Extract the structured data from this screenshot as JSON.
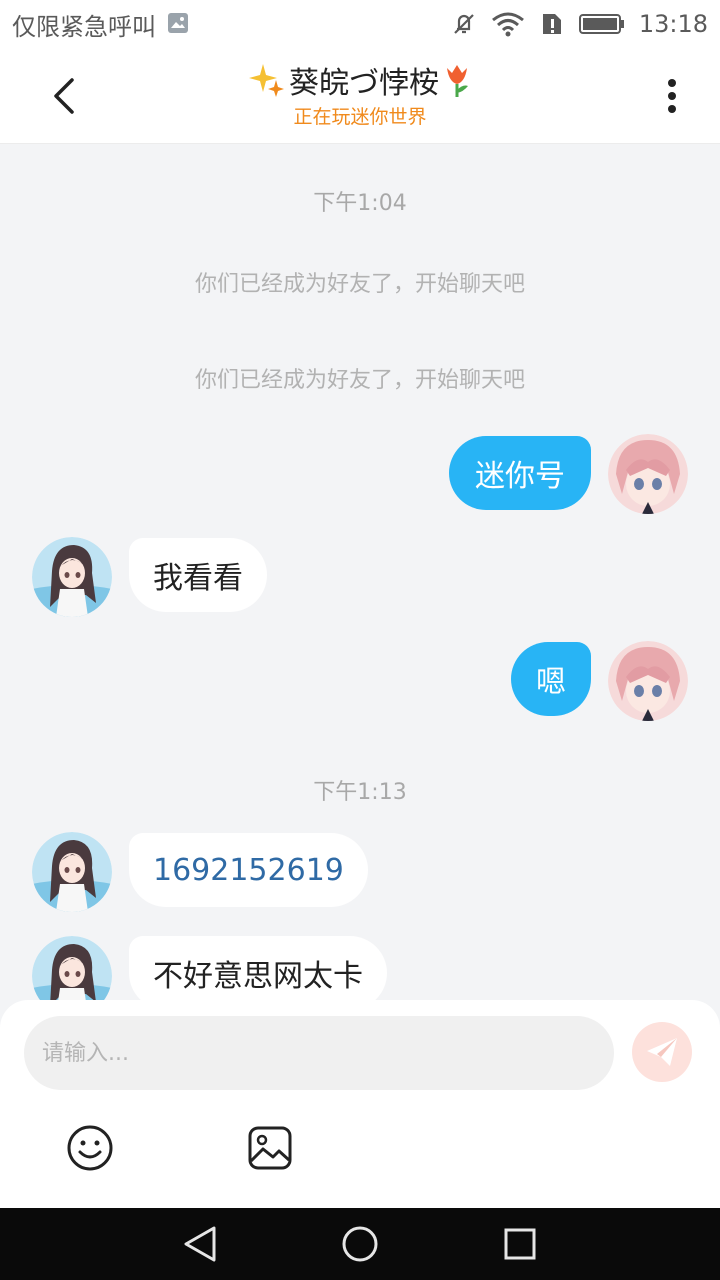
{
  "status_bar": {
    "carrier": "仅限紧急呼叫",
    "time": "13:18"
  },
  "header": {
    "back_icon": "chevron-left-icon",
    "title": "葵皖づ悖桉",
    "subtitle": "正在玩迷你世界",
    "more_icon": "vertical-ellipsis-icon",
    "accent_color": "#f08a1c"
  },
  "chat": {
    "timestamps": [
      "下午1:04",
      "下午1:13"
    ],
    "system_messages": [
      "你们已经成为好友了，开始聊天吧",
      "你们已经成为好友了，开始聊天吧"
    ],
    "messages": [
      {
        "side": "right",
        "text": "迷你号"
      },
      {
        "side": "left",
        "text": "我看看"
      },
      {
        "side": "right",
        "text": "嗯"
      },
      {
        "side": "left",
        "text": "1692152619"
      },
      {
        "side": "left",
        "text": "不好意思网太卡"
      }
    ],
    "sent_bubble_color": "#28b4f5",
    "received_bubble_color": "#ffffff"
  },
  "composer": {
    "placeholder": "请输入...",
    "value": "",
    "send_icon": "paper-plane-icon",
    "emoji_icon": "smiley-icon",
    "image_icon": "image-icon"
  },
  "nav": {
    "back": "triangle-back-icon",
    "home": "circle-home-icon",
    "recents": "square-recents-icon"
  }
}
